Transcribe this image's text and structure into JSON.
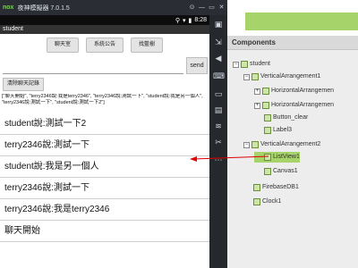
{
  "emulator": {
    "title": "夜神模擬器 7.0.1.5",
    "logo": "nox",
    "status_time": "8:28",
    "screen_title": "student",
    "window_controls": [
      "pin-icon",
      "minimize-icon",
      "maximize-icon",
      "close-icon"
    ]
  },
  "app": {
    "buttons": [
      "聊天室",
      "系統公告",
      "找藍樹"
    ],
    "send_label": "send",
    "clear_label": "清除聊天記錄",
    "label3_text": "[\"聊天開始\", \"terry2346說:我是terry2346\", \"terry2346說:測試一下\", \"student說:我是另一個人\", \"terry2346說:測試一下\", \"student說:測試一下2\"]",
    "list_items": [
      "student說:測試一下2",
      "terry2346說:測試一下",
      "student說:我是另一個人",
      "terry2346說:測試一下",
      "terry2346說:我是terry2346",
      "聊天開始"
    ]
  },
  "components": {
    "header": "Components",
    "tree": [
      {
        "label": "student",
        "level": 0,
        "toggle": "−",
        "icon": "screen-icon"
      },
      {
        "label": "VerticalArrangement1",
        "level": 1,
        "toggle": "−",
        "icon": "vertical-arrangement-icon"
      },
      {
        "label": "HorizontalArrangemen",
        "level": 2,
        "toggle": "+",
        "icon": "horizontal-arrangement-icon"
      },
      {
        "label": "HorizontalArrangemen",
        "level": 2,
        "toggle": "+",
        "icon": "horizontal-arrangement-icon"
      },
      {
        "label": "Button_clear",
        "level": 2,
        "toggle": "",
        "icon": "button-icon"
      },
      {
        "label": "Label3",
        "level": 2,
        "toggle": "",
        "icon": "label-icon"
      },
      {
        "label": "VerticalArrangement2",
        "level": 1,
        "toggle": "−",
        "icon": "vertical-arrangement-icon"
      },
      {
        "label": "ListView1",
        "level": 2,
        "toggle": "",
        "icon": "listview-icon",
        "selected": true
      },
      {
        "label": "Canvas1",
        "level": 2,
        "toggle": "",
        "icon": "canvas-icon"
      },
      {
        "label": "FirebaseDB1",
        "level": 1,
        "toggle": "",
        "icon": "firebase-icon"
      },
      {
        "label": "Clock1",
        "level": 1,
        "toggle": "",
        "icon": "clock-icon"
      }
    ]
  },
  "annotation_color": "#e00000"
}
